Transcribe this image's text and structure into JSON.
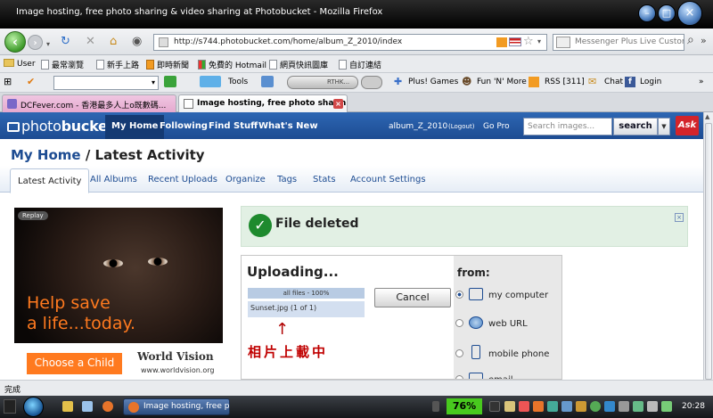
{
  "window": {
    "title": "Image hosting, free photo sharing & video sharing at Photobucket - Mozilla Firefox"
  },
  "navbar": {
    "url": "http://s744.photobucket.com/home/album_Z_2010/index",
    "search_placeholder": "Messenger Plus Live Custom"
  },
  "bookmarks": [
    {
      "label": "User",
      "icon": "folder-icon"
    },
    {
      "label": "最常瀏覽",
      "icon": "page-icon"
    },
    {
      "label": "新手上路",
      "icon": "page-icon"
    },
    {
      "label": "即時新聞",
      "icon": "rss-icon"
    },
    {
      "label": "免費的 Hotmail",
      "icon": "windows-icon"
    },
    {
      "label": "網頁快訊圖庫",
      "icon": "page-icon"
    },
    {
      "label": "自訂連結",
      "icon": "page-icon"
    }
  ],
  "toolbar": {
    "tools": "Tools",
    "player_text": "RTHK...",
    "plus_games": "Plus! Games",
    "fun_n_more": "Fun 'N' More",
    "rss": "RSS [311]",
    "chat": "Chat",
    "login": "Login"
  },
  "tabs": [
    {
      "label": "DCFever.com - 香港最多人上o既數碼...",
      "active": false
    },
    {
      "label": "Image hosting, free photo sharin...",
      "active": true
    }
  ],
  "photobucket": {
    "logo_light": "photo",
    "logo_bold": "bucket",
    "nav": [
      "My Home",
      "Following",
      "Find Stuff",
      "What's New"
    ],
    "album": "album_Z_2010",
    "logout": "(Logout)",
    "gopro": "Go Pro",
    "search_placeholder": "Search images...",
    "search_button": "search",
    "ask_logo": "Ask",
    "breadcrumb_home": "My Home",
    "breadcrumb_sep": " / ",
    "breadcrumb_current": "Latest Activity",
    "subtabs": [
      "Latest Activity",
      "All Albums",
      "Recent Uploads",
      "Organize",
      "Tags",
      "Stats",
      "Account Settings"
    ]
  },
  "ad": {
    "replay": "Replay",
    "help_line1": "Help save",
    "help_line2": "a life...today.",
    "choose_button": "Choose a Child",
    "brand": "World Vision",
    "brand_url": "www.worldvision.org"
  },
  "notice": {
    "text": "File deleted",
    "close": "×"
  },
  "upload": {
    "title": "Uploading...",
    "all_files": "all files - 100%",
    "file_row": "Sunset.jpg (1 of 1)",
    "annotation": "相片上載中",
    "cancel": "Cancel",
    "from_label": "from:",
    "options": [
      {
        "label": "my computer",
        "selected": true,
        "icon": "computer-icon"
      },
      {
        "label": "web URL",
        "selected": false,
        "icon": "globe-icon"
      },
      {
        "label": "mobile phone",
        "selected": false,
        "icon": "phone-icon"
      },
      {
        "label": "email",
        "selected": false,
        "icon": "email-icon"
      }
    ]
  },
  "status": {
    "text": "完成"
  },
  "taskbar": {
    "window_item": "Image hosting, free ph...",
    "battery": "76%",
    "clock": "20:28"
  }
}
